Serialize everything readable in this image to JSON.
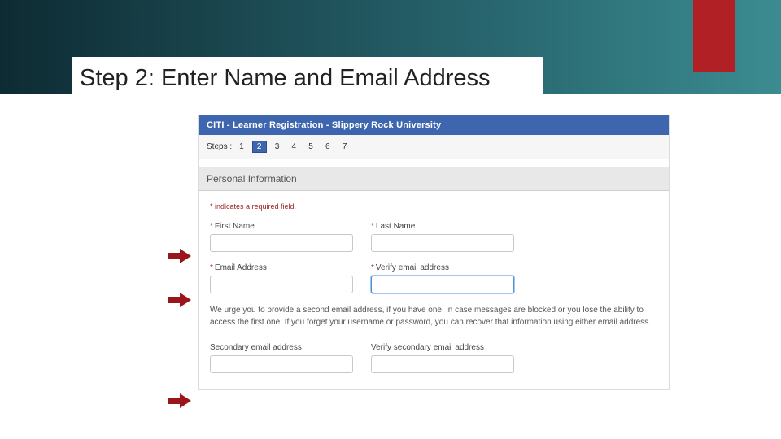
{
  "slide": {
    "title": "Step 2: Enter Name and Email Address"
  },
  "form": {
    "header": "CITI - Learner Registration - Slippery Rock University",
    "steps": {
      "label": "Steps :",
      "items": [
        "1",
        "2",
        "3",
        "4",
        "5",
        "6",
        "7"
      ],
      "current_index": 1
    },
    "section_title": "Personal Information",
    "required_note": "* indicates a required field.",
    "fields": {
      "first_name": {
        "label": "First Name",
        "required": true
      },
      "last_name": {
        "label": "Last Name",
        "required": true
      },
      "email": {
        "label": "Email Address",
        "required": true
      },
      "verify_email": {
        "label": "Verify email address",
        "required": true
      },
      "sec_email": {
        "label": "Secondary email address",
        "required": false
      },
      "verify_sec": {
        "label": "Verify secondary email address",
        "required": false
      }
    },
    "help_text": "We urge you to provide a second email address, if you have one, in case messages are blocked or you lose the ability to access the first one. If you forget your username or password, you can recover that information using either email address."
  }
}
